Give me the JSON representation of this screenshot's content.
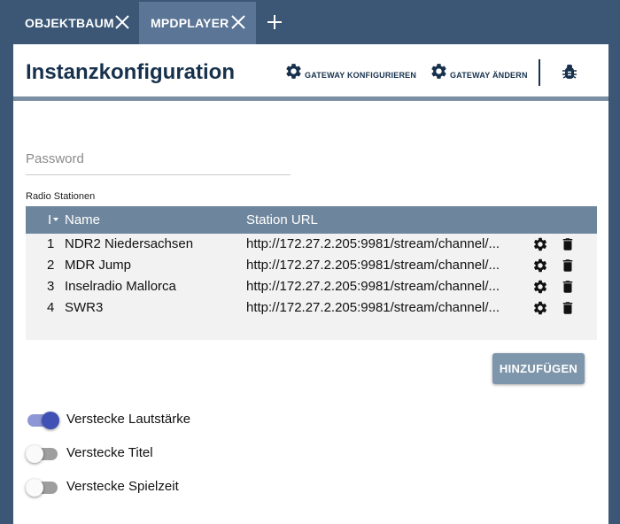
{
  "tabs": [
    {
      "label": "OBJEKTBAUM"
    },
    {
      "label": "MPDPLAYER"
    }
  ],
  "header": {
    "title": "Instanzkonfiguration",
    "gateway_configure": "GATEWAY KONFIGURIEREN",
    "gateway_change": "GATEWAY ÄNDERN"
  },
  "form": {
    "password_placeholder": "Password",
    "stations_label": "Radio Stationen"
  },
  "table": {
    "columns": {
      "num": "I",
      "name": "Name",
      "url": "Station URL"
    },
    "rows": [
      {
        "num": "1",
        "name": "NDR2 Niedersachsen",
        "url": "http://172.27.2.205:9981/stream/channel/..."
      },
      {
        "num": "2",
        "name": "MDR Jump",
        "url": "http://172.27.2.205:9981/stream/channel/..."
      },
      {
        "num": "3",
        "name": "Inselradio Mallorca",
        "url": "http://172.27.2.205:9981/stream/channel/..."
      },
      {
        "num": "4",
        "name": "SWR3",
        "url": "http://172.27.2.205:9981/stream/channel/..."
      }
    ]
  },
  "add_button": "HINZUFÜGEN",
  "switches": [
    {
      "label": "Verstecke Lautstärke",
      "checked": true
    },
    {
      "label": "Verstecke Titel",
      "checked": false
    },
    {
      "label": "Verstecke Spielzeit",
      "checked": false
    }
  ],
  "colors": {
    "topbar": "#3b5775",
    "active_tab": "#5a7595",
    "title_text": "#17314d",
    "table_header": "#6e869d",
    "button": "#7e96ab",
    "switch_on": "#3f51b5"
  }
}
